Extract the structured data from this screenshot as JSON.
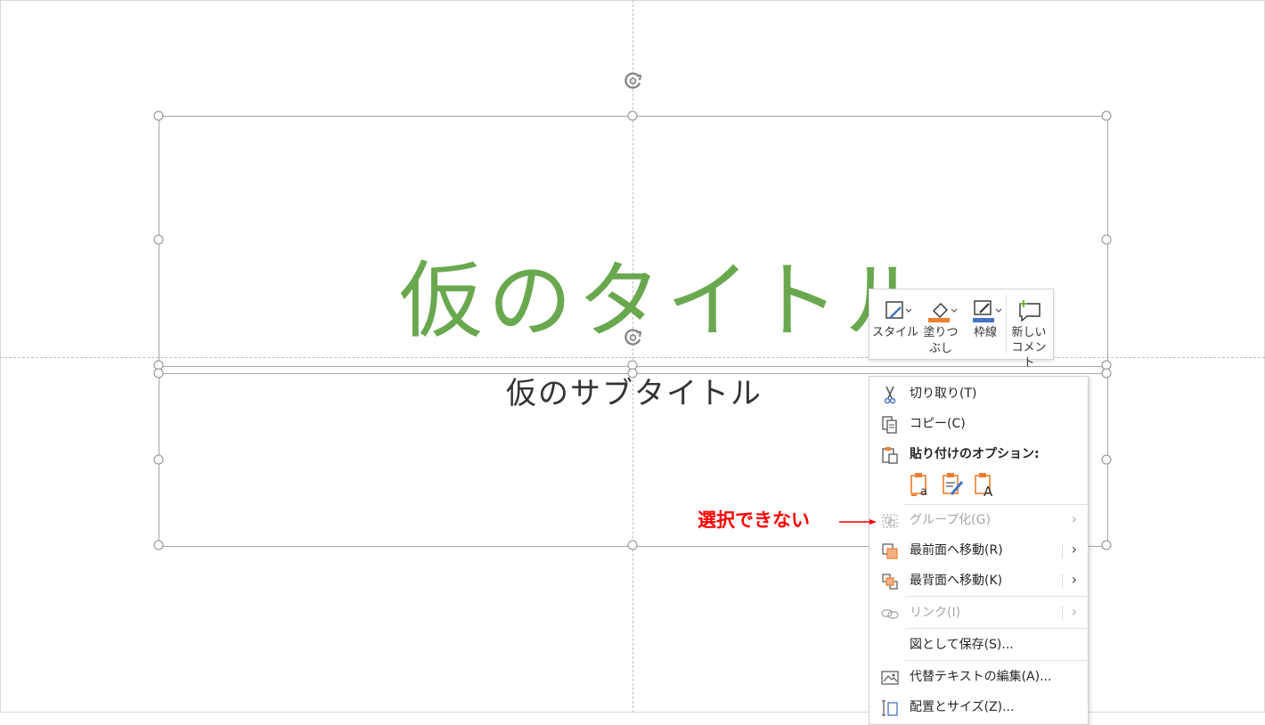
{
  "slide": {
    "title": "仮のタイトル",
    "subtitle": "仮のサブタイトル"
  },
  "mini_toolbar": {
    "style_label": "スタイル",
    "fill_label_1": "塗りつ",
    "fill_label_2": "ぶし",
    "outline_label": "枠線",
    "comment_label_1": "新しい",
    "comment_label_2": "コメント",
    "colors": {
      "fill": "#ed7d31",
      "outline": "#4472c4",
      "comment": "#70ad47"
    }
  },
  "context_menu": {
    "cut": "切り取り(T)",
    "copy": "コピー(C)",
    "paste_options": "貼り付けのオプション:",
    "group": "グループ化(G)",
    "bring_front": "最前面へ移動(R)",
    "send_back": "最背面へ移動(K)",
    "link": "リンク(I)",
    "save_as_picture": "図として保存(S)...",
    "alt_text": "代替テキストの編集(A)...",
    "size_position": "配置とサイズ(Z)..."
  },
  "annotation": {
    "text": "選択できない",
    "color": "#ff0000"
  },
  "colors": {
    "title": "#6aa84f",
    "accent": "#ed7d31"
  }
}
